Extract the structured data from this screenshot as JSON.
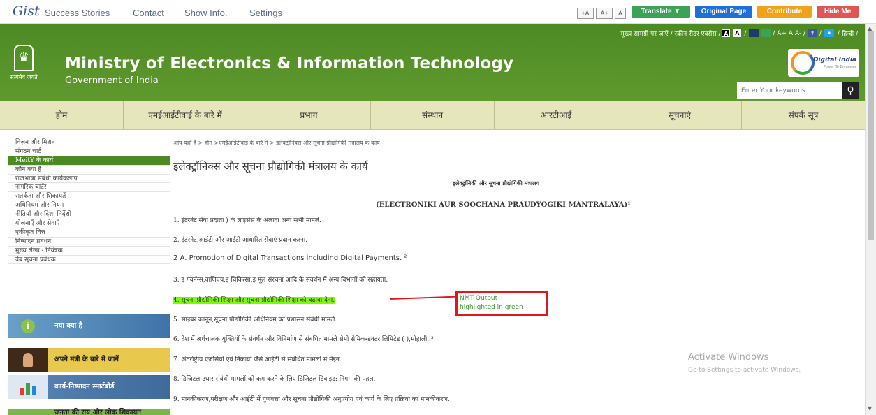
{
  "toolbar": {
    "logo": "Gist",
    "links": [
      "Success Stories",
      "Contact",
      "Show Info.",
      "Settings"
    ],
    "font_buttons": [
      "±A",
      "A±",
      "A"
    ],
    "translate": "Translate ▼",
    "original_page": "Original Page",
    "contribute": "Contribute",
    "hide_me": "Hide Me",
    "colors": {
      "translate": "#3aa356",
      "original": "#1e6fd8",
      "contribute": "#f0a21a",
      "hide": "#e25552"
    }
  },
  "header": {
    "access_links": "मुख्य सामग्री पर जाएँ / स्क्रीन रीडर एक्सेस /",
    "contrast_a1": "A",
    "contrast_a2": "A",
    "size_links": "/ A+ A A- /",
    "hindi": "हिन्दी /",
    "emblem_motto": "सत्यमेव जयते",
    "title": "Ministry of Electronics & Information Technology",
    "subtitle": "Government of India",
    "digital_india": "Digital India",
    "digital_india_tag": "Power To Empower",
    "search_placeholder": "Enter Your keywords",
    "search_icon": "search-icon"
  },
  "menu": [
    "होम",
    "एमईआईटीवाई के बारे में",
    "प्रभाग",
    "संस्थान",
    "आरटीआई",
    "सूचनाएं",
    "संपर्क सूत्र"
  ],
  "sidebar": {
    "items": [
      "विज़न और मिशन",
      "संगठन चार्ट",
      "MeitY के कार्य",
      "कौन क्या है",
      "राजभाषा संबंधी कार्यकलाप",
      "नागरिक चार्टर",
      "सतर्कता और शिकायतें",
      "अधिनियम और नियम",
      "नीतियाँ और दिशा निर्देशों",
      "योजनाएँ और सेवाएँ",
      "एकीकृत वित्त",
      "निष्पादन प्रबंधन",
      "मुख्य लेखा - नियंत्रक",
      "वेब सूचना प्रबंधक"
    ],
    "active_index": 2,
    "banners": [
      "नया क्या है",
      "अपने मंत्री के बारे में जानें",
      "कार्य-निष्पादन स्मार्टबोर्ड",
      "जनता की राय और लोक शिकायत"
    ]
  },
  "content": {
    "breadcrumb": "आप यहाँ हैं > होम >एमईआईटीवाई के बारे में > इलेक्ट्रॉनिक्स और सूचना प्रौद्योगिकी मंत्रालय के कार्य",
    "title": "इलेक्ट्रॉनिक्स और सूचना प्रौद्योगिकी मंत्रालय के कार्य",
    "sub_heading": "इलेक्ट्रॉनिकी और सूचना प्रौद्योगिकी मंत्रालय",
    "transliteration": "(ELECTRONIKI AUR SOOCHANA PRAUDYOGIKI MANTRALAYA)¹",
    "lines": [
      "1. इंटरनेट सेवा प्रदाता ) के लाइसेंस के अलावा अन्य सभी मामले.",
      "2. इंटरनेट,आईटी और आईटी आधारित सेवाएं प्रदान करना.",
      "2 A. Promotion of Digital Transactions including Digital Payments. ²",
      "3. इ गवर्नन्स,वाणिज्य,इ चिकित्सा,इ मूल संरचना आदि के संवर्धन में अन्य विभागों को सहायता.",
      "4. सूचना प्रौद्योगिकी शिक्षा और सूचना प्रौद्योगिकी शिक्षा को बढ़ावा देना.",
      "5. साइबर कानून,सूचना प्रौद्योगिकी अधिनियम का प्रशासन संबंधी मामले.",
      "6. देश में अर्धचालक युक्तियों के संवर्धन और विनिर्माण से संबंधित मामले सेमी सेमिकन्डक्टर लिमिटेड ( ),मोहाली. ³",
      "7. अंतर्राष्ट्रीय एजेंसियों एवं निकायों जैसे आईटी से संबंधित मामलों में मेंइन.",
      "8. डिजिटल उधार संबंधी मामलों को कम करने के लिए डिजिटल डिवाइड: निगम की पहल.",
      "9. मानकीकरण,परीक्षण और आईटी में गुणवत्ता और सूचना प्रौद्योगिकी अनुप्रयोग एवं कार्य के लिए प्रक्रिया का मानकीकरण."
    ],
    "highlighted_index": 4,
    "annotation": [
      "NMT Output",
      "highlighted in green"
    ],
    "watermark_title": "Activate Windows",
    "watermark_sub": "Go to Settings to activate Windows."
  }
}
